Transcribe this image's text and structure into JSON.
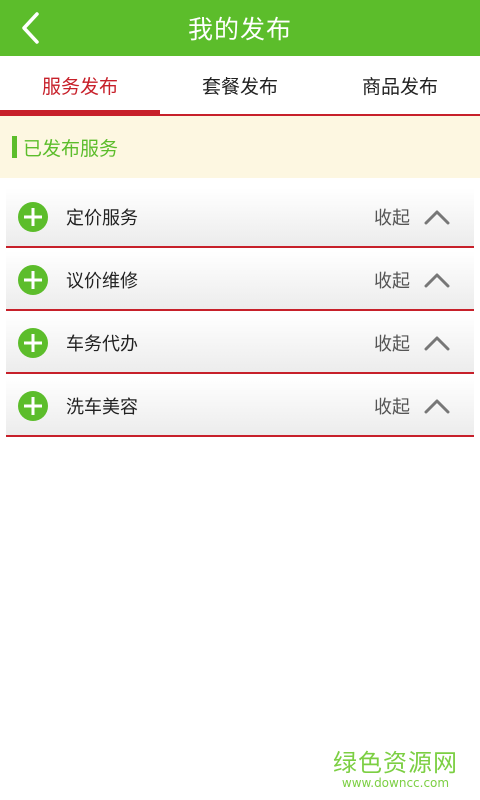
{
  "header": {
    "title": "我的发布",
    "back_icon": "chevron-left-icon"
  },
  "tabs": [
    {
      "label": "服务发布",
      "active": true
    },
    {
      "label": "套餐发布",
      "active": false
    },
    {
      "label": "商品发布",
      "active": false
    }
  ],
  "section": {
    "title": "已发布服务"
  },
  "list": {
    "items": [
      {
        "label": "定价服务",
        "toggle": "收起"
      },
      {
        "label": "议价维修",
        "toggle": "收起"
      },
      {
        "label": "车务代办",
        "toggle": "收起"
      },
      {
        "label": "洗车美容",
        "toggle": "收起"
      }
    ]
  },
  "watermark": {
    "main": "绿色资源网",
    "url": "www.downcc.com"
  },
  "colors": {
    "primary_green": "#5cbd2b",
    "accent_red": "#c7202a",
    "section_bg": "#fdf7e1"
  }
}
